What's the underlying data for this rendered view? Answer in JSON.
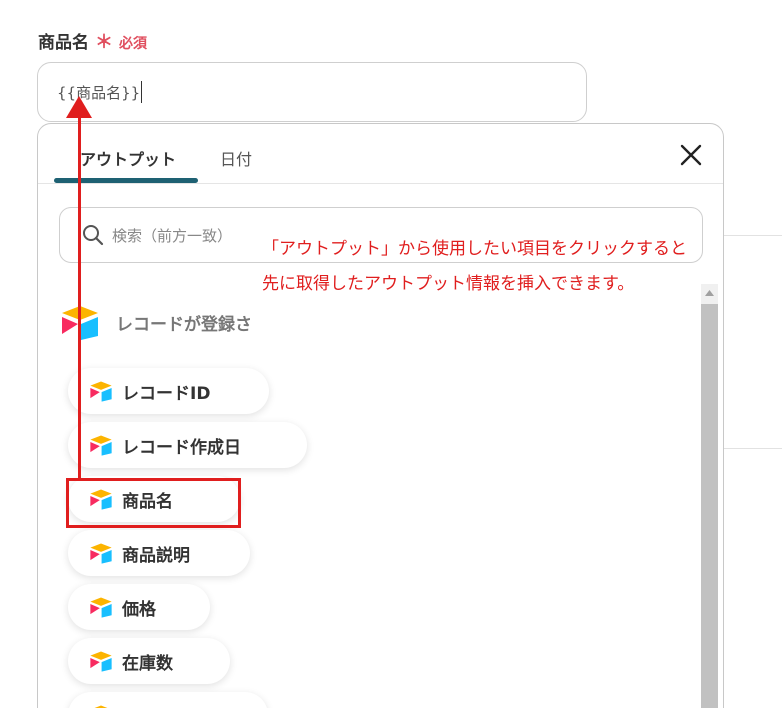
{
  "field": {
    "label": "商品名",
    "required_mark": "＊",
    "required_text": "必須",
    "value": "{{商品名}}"
  },
  "popup": {
    "tabs": [
      {
        "label": "アウトプット",
        "active": true
      },
      {
        "label": "日付",
        "active": false
      }
    ],
    "close_icon": "close-icon",
    "search": {
      "placeholder": "検索（前方一致）",
      "icon": "search-icon"
    },
    "group": {
      "title": "レコードが登録さ",
      "icon": "airtable-logo-icon"
    },
    "items": [
      {
        "label": "レコードID"
      },
      {
        "label": "レコード作成日"
      },
      {
        "label": "商品名",
        "highlighted": true
      },
      {
        "label": "商品説明"
      },
      {
        "label": "価格"
      },
      {
        "label": "在庫数"
      },
      {
        "label": ""
      }
    ]
  },
  "annotation": {
    "line1": "「アウトプット」から使用したい項目をクリックすると",
    "line2": "先に取得したアウトプット情報を挿入できます。",
    "color": "#e01e1e"
  },
  "colors": {
    "accent": "#1e6173",
    "required": "#e04f5f",
    "logo_yellow": "#fcb400",
    "logo_blue": "#18bfff",
    "logo_red": "#f82b60"
  }
}
